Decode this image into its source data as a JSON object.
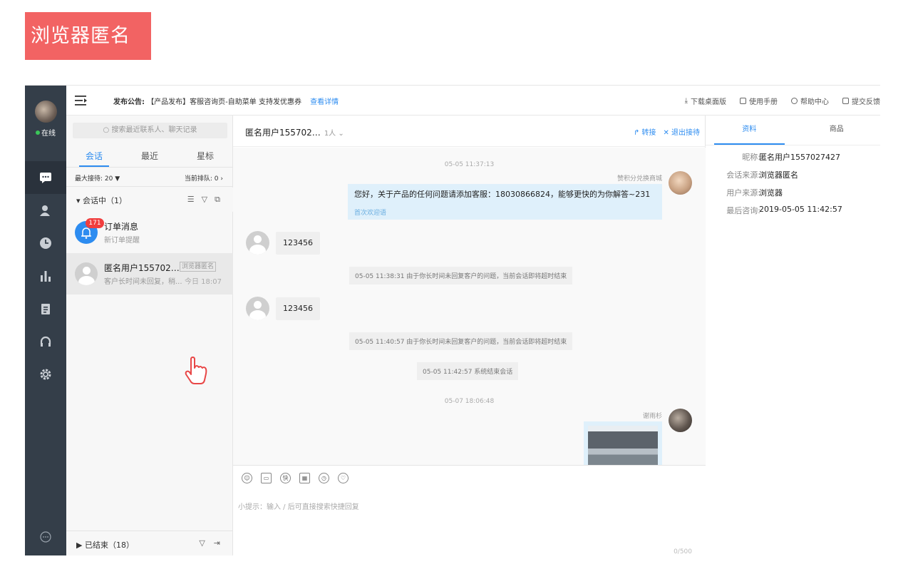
{
  "banner": "浏览器匿名",
  "nav": {
    "status": "在线"
  },
  "topbar": {
    "notice_label": "发布公告:",
    "notice_text": "【产品发布】客服咨询页-自助菜单 支持发优惠券",
    "notice_link": "查看详情",
    "tools": [
      "下载桌面版",
      "使用手册",
      "帮助中心",
      "提交反馈"
    ]
  },
  "list": {
    "search_placeholder": "搜索最近联系人、聊天记录",
    "tabs": [
      "会话",
      "最近",
      "星标"
    ],
    "max_label": "最大接待: 20 ▼",
    "queue_label": "当前排队: 0 ›",
    "active_section": "▾ 会话中（1）",
    "conversations": [
      {
        "name": "订单消息",
        "sub": "新订单提醒",
        "badge": "171"
      },
      {
        "name": "匿名用户155702…",
        "sub": "客户长时间未回复，稍...",
        "tag": "浏览器匿名",
        "time": "今日 18:07"
      }
    ],
    "ended_section": "▶ 已结束（18）"
  },
  "chat": {
    "title": "匿名用户155702…",
    "count": "1人 ⌄",
    "forward": "↱ 转接",
    "exit": "✕ 退出接待",
    "messages": {
      "ts1": "05-05 11:37:13",
      "sender1": "赞积分兑换商城",
      "out1": "您好，关于产品的任何问题请添加客服：18030866824，能够更快的为你解答~231",
      "out1_tag": "首次欢迎语",
      "in1": "123456",
      "sys1": "05-05 11:38:31 由于你长时间未回复客户的问题，当前会话即将超时结束",
      "in2": "123456",
      "sys2": "05-05 11:40:57 由于你长时间未回复客户的问题，当前会话即将超时结束",
      "sys3": "05-05 11:42:57 系统结束会话",
      "ts2": "05-07 18:06:48",
      "sender2": "谢雨杉"
    },
    "input_hint": "小提示：输入 / 后可直接搜索快捷回复",
    "char_count": "0/500"
  },
  "info": {
    "tabs": [
      "资料",
      "商品"
    ],
    "rows": [
      {
        "k": "昵称:",
        "v": "匿名用户1557027427"
      },
      {
        "k": "会话来源:",
        "v": "浏览器匿名"
      },
      {
        "k": "用户来源:",
        "v": "浏览器"
      },
      {
        "k": "最后咨询:",
        "v": "2019-05-05 11:42:57"
      }
    ]
  }
}
